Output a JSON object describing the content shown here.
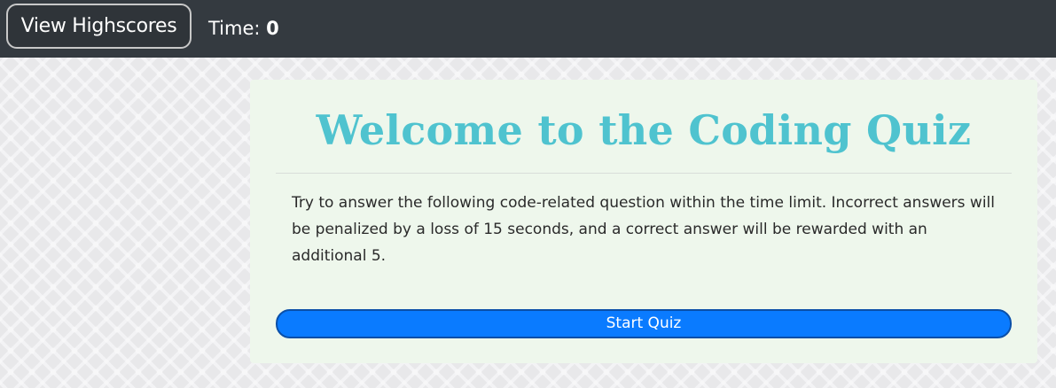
{
  "navbar": {
    "highscores_label": "View Highscores",
    "timer_label": "Time:",
    "timer_value": "0"
  },
  "card": {
    "title": "Welcome to the Coding Quiz",
    "description": "Try to answer the following code-related question within the time limit. Incorrect answers will be penalized by a loss of 15 seconds, and a correct answer will be rewarded with an additional 5.",
    "start_label": "Start Quiz"
  },
  "colors": {
    "navbar_bg": "#343a40",
    "title": "#4fc3cf",
    "card_bg": "#eef7ec",
    "start_button_bg": "#0a7bff"
  }
}
